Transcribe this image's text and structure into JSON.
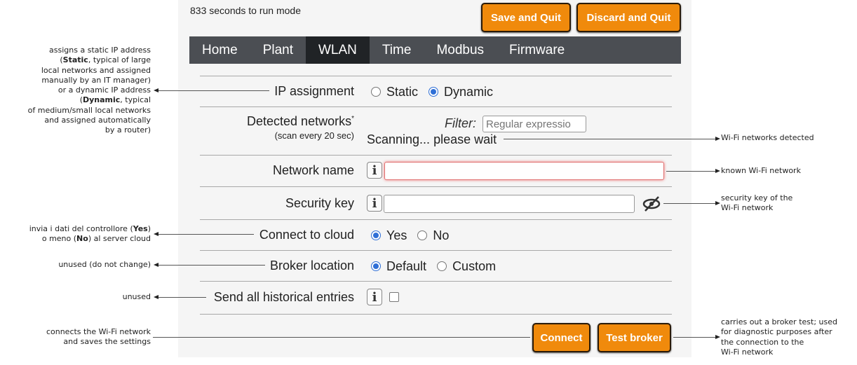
{
  "header": {
    "countdown": "833 seconds to run mode",
    "save_quit": "Save and Quit",
    "discard_quit": "Discard and Quit"
  },
  "nav": {
    "tabs": [
      "Home",
      "Plant",
      "WLAN",
      "Time",
      "Modbus",
      "Firmware"
    ],
    "active": "WLAN"
  },
  "form": {
    "ip_assignment": {
      "label": "IP assignment",
      "options": [
        "Static",
        "Dynamic"
      ],
      "selected": "Dynamic"
    },
    "detected": {
      "label": "Detected networks",
      "asterisk": "*",
      "sub": "(scan every 20 sec)",
      "filter_label": "Filter:",
      "filter_placeholder": "Regular expressio",
      "status": "Scanning... please wait"
    },
    "network_name": {
      "label": "Network name",
      "value": ""
    },
    "security_key": {
      "label": "Security key",
      "value": ""
    },
    "cloud": {
      "label": "Connect to cloud",
      "options": [
        "Yes",
        "No"
      ],
      "selected": "Yes"
    },
    "broker": {
      "label": "Broker location",
      "options": [
        "Default",
        "Custom"
      ],
      "selected": "Default"
    },
    "historical": {
      "label": "Send all historical entries",
      "checked": false
    },
    "connect": "Connect",
    "test_broker": "Test broker",
    "info_glyph": "i"
  },
  "annotations": {
    "ip": {
      "l1": "assigns a static IP address",
      "l2a": "(",
      "l2b": "Static",
      "l2c": ", typical of large",
      "l3": "local networks and assigned",
      "l4": "manually by an IT manager)",
      "l5": "or a dynamic IP address",
      "l6a": "(",
      "l6b": "Dynamic",
      "l6c": ", typical",
      "l7": "of medium/small local networks",
      "l8": "and assigned automatically",
      "l9": "by a router)"
    },
    "cloud": {
      "a": "invia i dati del controllore (",
      "b": "Yes",
      "c": ")",
      "d": "o meno (",
      "e": "No",
      "f": ") al server cloud"
    },
    "broker": "unused (do not change)",
    "historical": "unused",
    "connect": {
      "l1": "connects the Wi-Fi network",
      "l2": "and saves the settings"
    },
    "detected": "Wi-Fi networks detected",
    "network_name": "known Wi-Fi network",
    "security": {
      "l1": "security key of the",
      "l2": "Wi-Fi network"
    },
    "test": {
      "l1": "carries out a broker test; used",
      "l2": "for diagnostic purposes after",
      "l3": "the connection to the",
      "l4": "Wi-Fi network"
    }
  },
  "colors": {
    "accent": "#f08a0c",
    "nav": "#4b4e53",
    "nav_active": "#202326",
    "radio": "#2f6fd6"
  }
}
